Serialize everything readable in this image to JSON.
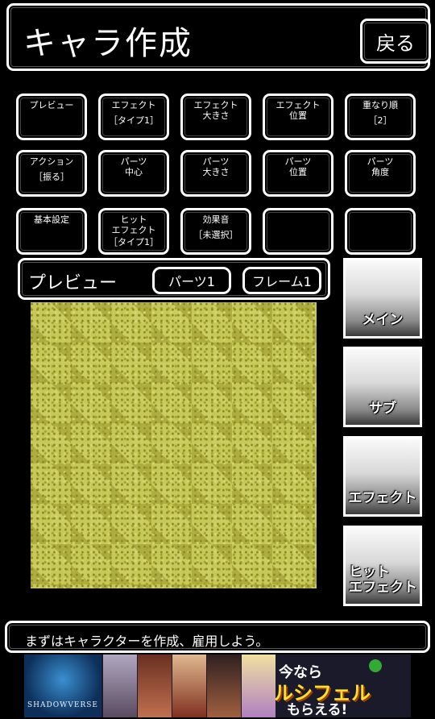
{
  "header": {
    "title": "キャラ作成",
    "back_label": "戻る"
  },
  "tools": [
    {
      "label": "プレビュー",
      "value": ""
    },
    {
      "label": "エフェクト",
      "value": "［タイプ1］"
    },
    {
      "label": "エフェクト\n大きさ",
      "value": ""
    },
    {
      "label": "エフェクト\n位置",
      "value": ""
    },
    {
      "label": "重なり順",
      "value": "［2］"
    },
    {
      "label": "アクション",
      "value": "［振る］"
    },
    {
      "label": "パーツ\n中心",
      "value": ""
    },
    {
      "label": "パーツ\n大きさ",
      "value": ""
    },
    {
      "label": "パーツ\n位置",
      "value": ""
    },
    {
      "label": "パーツ\n角度",
      "value": ""
    },
    {
      "label": "基本設定",
      "value": ""
    },
    {
      "label": "ヒット\nエフェクト",
      "value": "［タイプ1］"
    },
    {
      "label": "効果音",
      "value": "［未選択］"
    },
    {
      "label": "",
      "value": ""
    },
    {
      "label": "",
      "value": ""
    }
  ],
  "preview": {
    "title": "プレビュー",
    "parts_button": "パーツ1",
    "frame_button": "フレーム1"
  },
  "side_buttons": {
    "main": "メイン",
    "sub": "サブ",
    "effect": "エフェクト",
    "hit_effect": "ヒット\nエフェクト"
  },
  "message": "まずはキャラクターを作成、雇用しよう。",
  "ad": {
    "logo_text": "SHADOWVERSE",
    "line1": "今なら",
    "line2": "ルシフェル",
    "line3": "もらえる!"
  }
}
